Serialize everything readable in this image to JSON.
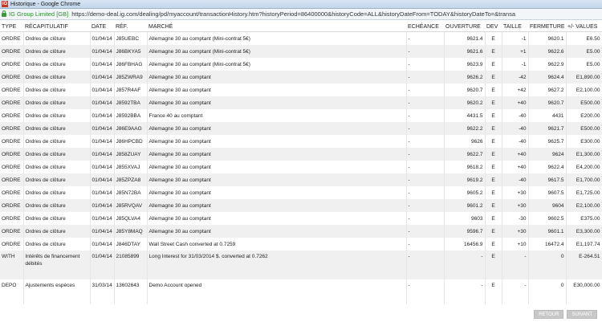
{
  "window": {
    "title": "Historique - Google Chrome"
  },
  "address": {
    "site_identity": "IG Group Limited [GB]",
    "url": "https://demo-deal.ig.com/dealing/pd/myaccount/transactionHistory.htm?historyPeriod=86400000&historyCode=ALL&historyDateFrom=TODAY&historyDateTo=&transa"
  },
  "table": {
    "headers": {
      "type": "TYPE",
      "summary": "RÉCAPITULATIF",
      "date": "DATE",
      "ref": "RÉF.",
      "market": "MARCHÉ",
      "expiry": "ECHÉANCE",
      "open": "OUVERTURE",
      "currency": "DEV",
      "size": "TAILLE",
      "close": "FERMETURE",
      "pnl": "+/- VALUES"
    },
    "rows": [
      {
        "type": "ORDRE",
        "summary": "Ordres de clôture",
        "date": "01/04/14",
        "ref": "J85UEBC",
        "market": "Allemagne 30 au comptant (Mini-contrat 5€)",
        "expiry": "-",
        "open": "9621.4",
        "currency": "E",
        "size": "-1",
        "close": "9620.1",
        "pnl": "E6.50"
      },
      {
        "type": "ORDRE",
        "summary": "Ordres de clôture",
        "date": "01/04/14",
        "ref": "J86BKYA5",
        "market": "Allemagne 30 au comptant (Mini-contrat 5€)",
        "expiry": "-",
        "open": "9621.6",
        "currency": "E",
        "size": "+1",
        "close": "9622.6",
        "pnl": "E5.00"
      },
      {
        "type": "ORDRE",
        "summary": "Ordres de clôture",
        "date": "01/04/14",
        "ref": "J86FBHAG",
        "market": "Allemagne 30 au comptant (Mini-contrat 5€)",
        "expiry": "-",
        "open": "9623.9",
        "currency": "E",
        "size": "-1",
        "close": "9622.9",
        "pnl": "E5.00"
      },
      {
        "type": "ORDRE",
        "summary": "Ordres de clôture",
        "date": "01/04/14",
        "ref": "J85ZWRA9",
        "market": "Allemagne 30 au comptant",
        "expiry": "-",
        "open": "9626.2",
        "currency": "E",
        "size": "-42",
        "close": "9624.4",
        "pnl": "E1,890.00"
      },
      {
        "type": "ORDRE",
        "summary": "Ordres de clôture",
        "date": "01/04/14",
        "ref": "J857R4AF",
        "market": "Allemagne 30 au comptant",
        "expiry": "-",
        "open": "9620.7",
        "currency": "E",
        "size": "+42",
        "close": "9627.2",
        "pnl": "E2,100.00"
      },
      {
        "type": "ORDRE",
        "summary": "Ordres de clôture",
        "date": "01/04/14",
        "ref": "J8592TBA",
        "market": "Allemagne 30 au comptant",
        "expiry": "-",
        "open": "9620.2",
        "currency": "E",
        "size": "+40",
        "close": "9620.7",
        "pnl": "E500.00"
      },
      {
        "type": "ORDRE",
        "summary": "Ordres de clôture",
        "date": "01/04/14",
        "ref": "J8592BBA",
        "market": "France 40 au comptant",
        "expiry": "-",
        "open": "4431.5",
        "currency": "E",
        "size": "-40",
        "close": "4431",
        "pnl": "E200.00"
      },
      {
        "type": "ORDRE",
        "summary": "Ordres de clôture",
        "date": "01/04/14",
        "ref": "J86E9AAG",
        "market": "Allemagne 30 au comptant",
        "expiry": "-",
        "open": "9622.2",
        "currency": "E",
        "size": "-40",
        "close": "9621.7",
        "pnl": "E500.00"
      },
      {
        "type": "ORDRE",
        "summary": "Ordres de clôture",
        "date": "01/04/14",
        "ref": "J86HPCBD",
        "market": "Allemagne 30 au comptant",
        "expiry": "-",
        "open": "9626",
        "currency": "E",
        "size": "-40",
        "close": "9625.7",
        "pnl": "E300.00"
      },
      {
        "type": "ORDRE",
        "summary": "Ordres de clôture",
        "date": "01/04/14",
        "ref": "J858ZUAY",
        "market": "Allemagne 30 au comptant",
        "expiry": "-",
        "open": "9622.7",
        "currency": "E",
        "size": "+40",
        "close": "9624",
        "pnl": "E1,300.00"
      },
      {
        "type": "ORDRE",
        "summary": "Ordres de clôture",
        "date": "01/04/14",
        "ref": "J855XVAJ",
        "market": "Allemagne 30 au comptant",
        "expiry": "-",
        "open": "9618.2",
        "currency": "E",
        "size": "+40",
        "close": "9622.4",
        "pnl": "E4,200.00"
      },
      {
        "type": "ORDRE",
        "summary": "Ordres de clôture",
        "date": "01/04/14",
        "ref": "J85ZPZA8",
        "market": "Allemagne 30 au comptant",
        "expiry": "-",
        "open": "9619.2",
        "currency": "E",
        "size": "-40",
        "close": "9617.5",
        "pnl": "E1,700.00"
      },
      {
        "type": "ORDRE",
        "summary": "Ordres de clôture",
        "date": "01/04/14",
        "ref": "J85N72BA",
        "market": "Allemagne 30 au comptant",
        "expiry": "-",
        "open": "9605.2",
        "currency": "E",
        "size": "+30",
        "close": "9607.5",
        "pnl": "E1,725.00"
      },
      {
        "type": "ORDRE",
        "summary": "Ordres de clôture",
        "date": "01/04/14",
        "ref": "J85RVQAV",
        "market": "Allemagne 30 au comptant",
        "expiry": "-",
        "open": "9601.2",
        "currency": "E",
        "size": "+30",
        "close": "9604",
        "pnl": "E2,100.00"
      },
      {
        "type": "ORDRE",
        "summary": "Ordres de clôture",
        "date": "01/04/14",
        "ref": "J85QLVA4",
        "market": "Allemagne 30 au comptant",
        "expiry": "-",
        "open": "9603",
        "currency": "E",
        "size": "-30",
        "close": "9602.5",
        "pnl": "E375.00"
      },
      {
        "type": "ORDRE",
        "summary": "Ordres de clôture",
        "date": "01/04/14",
        "ref": "J85Y8MAQ",
        "market": "Allemagne 30 au comptant",
        "expiry": "-",
        "open": "9596.7",
        "currency": "E",
        "size": "+30",
        "close": "9601.1",
        "pnl": "E3,300.00"
      },
      {
        "type": "ORDRE",
        "summary": "Ordres de clôture",
        "date": "01/04/14",
        "ref": "J846DTAY",
        "market": "Wall Street Cash converted at 0.7259",
        "expiry": "-",
        "open": "16456.9",
        "currency": "E",
        "size": "+10",
        "close": "16472.4",
        "pnl": "E1,197.74"
      },
      {
        "type": "WITH",
        "summary": "Intérêts de financement débités",
        "date": "01/04/14",
        "ref": "21085899",
        "market": "Long Interest for 31/03/2014 $. converted at 0.7262",
        "expiry": "-",
        "open": "-",
        "currency": "E",
        "size": "-",
        "close": "0",
        "pnl": "E-264.51"
      },
      {
        "type": "DEPO",
        "summary": "Ajustements espèces",
        "date": "31/03/14",
        "ref": "13602643",
        "market": "Demo Account opened",
        "expiry": "-",
        "open": "-",
        "currency": "E",
        "size": "-",
        "close": "0",
        "pnl": "E30,000.00"
      }
    ]
  },
  "buttons": {
    "back": "RETOUR",
    "next": "SUIVANT"
  }
}
